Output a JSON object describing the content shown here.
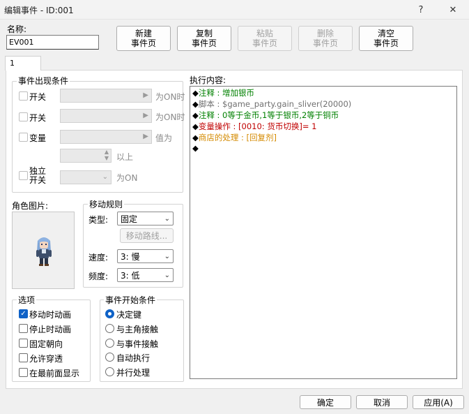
{
  "window": {
    "title": "编辑事件 - ID:001",
    "help_label": "?",
    "close_label": "✕"
  },
  "name": {
    "label": "名称:",
    "value": "EV001"
  },
  "toolbar": {
    "new_line1": "新建",
    "new_line2": "事件页",
    "copy_line1": "复制",
    "copy_line2": "事件页",
    "paste_line1": "粘贴",
    "paste_line2": "事件页",
    "delete_line1": "删除",
    "delete_line2": "事件页",
    "clear_line1": "清空",
    "clear_line2": "事件页"
  },
  "tabs": [
    {
      "label": "1"
    }
  ],
  "conditions": {
    "title": "事件出现条件",
    "switch1_label": "开关",
    "switch1_suffix": "为ON时",
    "switch2_label": "开关",
    "switch2_suffix": "为ON时",
    "variable_label": "变量",
    "variable_suffix": "值为",
    "variable_min_suffix": "以上",
    "self_switch_line1": "独立",
    "self_switch_line2": "开关",
    "self_switch_suffix": "为ON"
  },
  "graphic": {
    "label": "角色图片:"
  },
  "movement": {
    "title": "移动规则",
    "type_label": "类型:",
    "type_value": "固定",
    "route_button": "移动路线...",
    "speed_label": "速度:",
    "speed_value": "3: 慢",
    "freq_label": "频度:",
    "freq_value": "3: 低"
  },
  "options": {
    "title": "选项",
    "items": [
      {
        "label": "移动时动画",
        "checked": true
      },
      {
        "label": "停止时动画",
        "checked": false
      },
      {
        "label": "固定朝向",
        "checked": false
      },
      {
        "label": "允许穿透",
        "checked": false
      },
      {
        "label": "在最前面显示",
        "checked": false
      }
    ]
  },
  "trigger": {
    "title": "事件开始条件",
    "items": [
      {
        "label": "决定键",
        "selected": true
      },
      {
        "label": "与主角接触",
        "selected": false
      },
      {
        "label": "与事件接触",
        "selected": false
      },
      {
        "label": "自动执行",
        "selected": false
      },
      {
        "label": "并行处理",
        "selected": false
      }
    ]
  },
  "contents": {
    "label": "执行内容:",
    "lines": [
      {
        "bullet": "◆",
        "head": "注释",
        "sep": ":",
        "body": "增加银币",
        "color": "#008000"
      },
      {
        "bullet": "◆",
        "head": "脚本",
        "sep": ":",
        "body": "$game_party.gain_sliver(20000)",
        "color": "#707070"
      },
      {
        "bullet": "◆",
        "head": "注释",
        "sep": ":",
        "body": "0等于金币,1等于银币,2等于铜币",
        "color": "#008000"
      },
      {
        "bullet": "◆",
        "head": "变量操作",
        "sep": ":",
        "body": "[0010: 货币切换]= 1",
        "color": "#c00000"
      },
      {
        "bullet": "◆",
        "head": "商店的处理",
        "sep": ":",
        "body": "[回复剂]",
        "color": "#d48a00"
      },
      {
        "bullet": "◆",
        "head": "",
        "sep": "",
        "body": "",
        "color": "#000000"
      }
    ]
  },
  "footer": {
    "ok": "确定",
    "cancel": "取消",
    "apply": "应用(A)"
  }
}
